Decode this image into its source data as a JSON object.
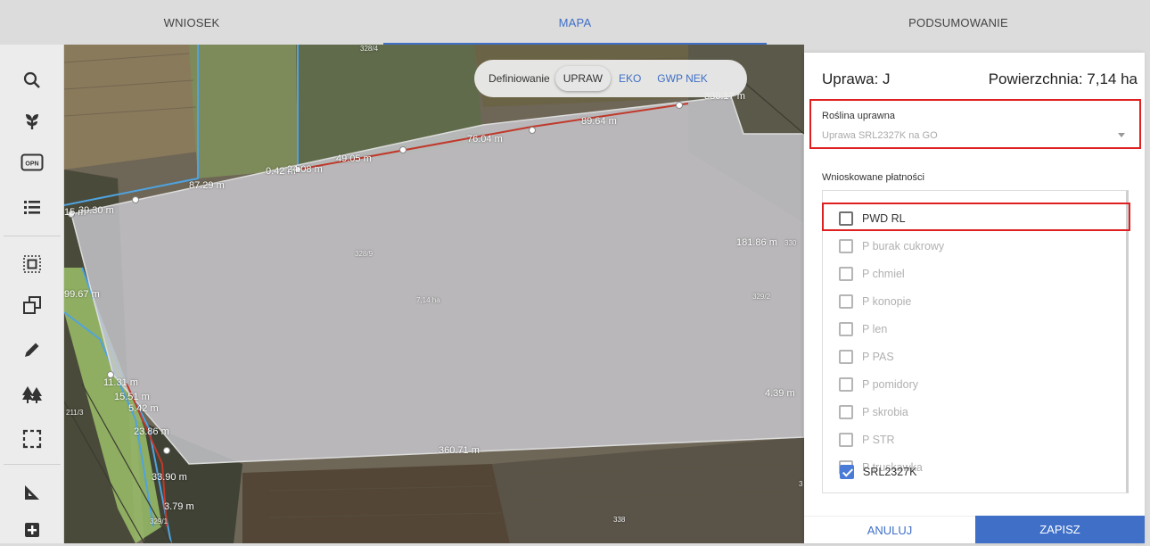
{
  "nav": {
    "tabs": [
      {
        "label": "WNIOSEK"
      },
      {
        "label": "MAPA"
      },
      {
        "label": "PODSUMOWANIE"
      }
    ],
    "active_tab": "MAPA"
  },
  "toolbar": {
    "tools": [
      "search-icon",
      "plant-icon",
      "opn-icon",
      "list-icon",
      "select-area-icon",
      "copy-icon",
      "edit-pencil-icon",
      "trees-icon",
      "selection-frame-icon",
      "measure-angle-icon",
      "add-icon"
    ],
    "opn_label": "OPN"
  },
  "define_toggle": {
    "label": "Definiowanie",
    "options": [
      "UPRAW",
      "EKO",
      "GWP NEK"
    ],
    "selected": "UPRAW"
  },
  "map": {
    "parcel_area_label": "7,14 ha",
    "parcel_ids": [
      "328/4",
      "328/9",
      "329/2",
      "211/3",
      "329/1",
      "338",
      "330",
      "3"
    ],
    "measurements": [
      "89.64 m",
      "76.04 m",
      "49.05 m",
      "0.42 m",
      "24.08 m",
      "87.29 m",
      "39.30 m",
      "15 m",
      "181.86 m",
      "99.67 m",
      "11.31 m",
      "15.51 m",
      "5.42 m",
      "23.86 m",
      "33.90 m",
      "3.79 m",
      "360.71 m",
      "4.39 m",
      "330.17 m"
    ],
    "colors": {
      "parcel_border": "#4fa3e0",
      "edge_red": "#c0392b",
      "grass": "#9bbf6a"
    }
  },
  "panel": {
    "crop_title": "Uprawa: J",
    "area_title": "Powierzchnia: 7,14 ha",
    "crop_select_label": "Roślina uprawna",
    "crop_select_value": "Uprawa SRL2327K na GO",
    "payments_label": "Wnioskowane płatności",
    "payments": [
      {
        "label": "PWD RL",
        "checked": false,
        "enabled": true
      },
      {
        "label": "P burak cukrowy",
        "checked": false,
        "enabled": false
      },
      {
        "label": "P chmiel",
        "checked": false,
        "enabled": false
      },
      {
        "label": "P konopie",
        "checked": false,
        "enabled": false
      },
      {
        "label": "P len",
        "checked": false,
        "enabled": false
      },
      {
        "label": "P PAS",
        "checked": false,
        "enabled": false
      },
      {
        "label": "P pomidory",
        "checked": false,
        "enabled": false
      },
      {
        "label": "P skrobia",
        "checked": false,
        "enabled": false
      },
      {
        "label": "P STR",
        "checked": false,
        "enabled": false
      },
      {
        "label": "P truskawka",
        "checked": false,
        "enabled": false
      },
      {
        "label": "SRL2327K",
        "checked": true,
        "enabled": true
      }
    ]
  },
  "actions": {
    "cancel_label": "ANULUJ",
    "save_label": "ZAPISZ"
  },
  "colors": {
    "accent": "#3f6fc7",
    "highlight_red": "#e02020"
  }
}
